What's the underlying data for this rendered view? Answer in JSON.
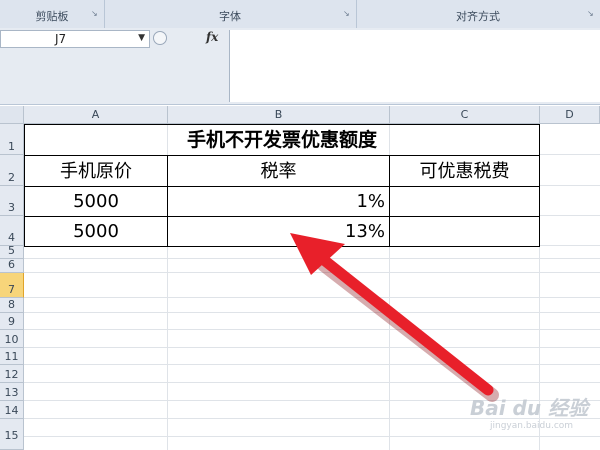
{
  "ribbon": {
    "groups": [
      {
        "label": "剪贴板"
      },
      {
        "label": "字体"
      },
      {
        "label": "对齐方式"
      }
    ]
  },
  "formula_bar": {
    "name_box": "J7",
    "fx_label": "fx",
    "formula": ""
  },
  "sheet": {
    "columns": [
      "A",
      "B",
      "C",
      "D"
    ],
    "rows": [
      "1",
      "2",
      "3",
      "4",
      "5",
      "6",
      "7",
      "8",
      "9",
      "10",
      "11",
      "12",
      "13",
      "14",
      "15"
    ],
    "active_row": "7",
    "table": {
      "title": "手机不开发票优惠额度",
      "headers": [
        "手机原价",
        "税率",
        "可优惠税费"
      ],
      "rows": [
        {
          "price": "5000",
          "rate": "1%",
          "discount": ""
        },
        {
          "price": "5000",
          "rate": "13%",
          "discount": ""
        }
      ]
    }
  },
  "annotation": {
    "arrow_color": "#e8202a"
  },
  "watermark": {
    "text": "Bai du 经验",
    "url": "jingyan.baidu.com"
  }
}
